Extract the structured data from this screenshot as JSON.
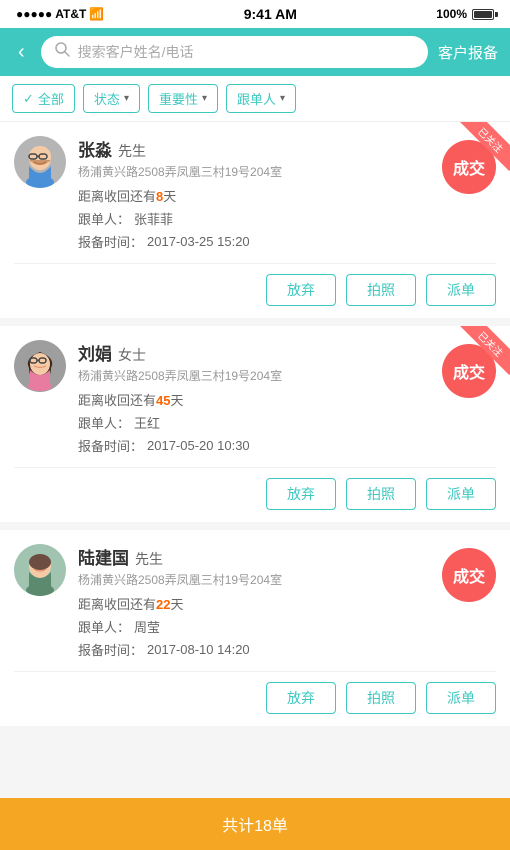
{
  "statusBar": {
    "carrier": "AT&T",
    "wifi": "WiFi",
    "time": "9:41 AM",
    "battery": "100%"
  },
  "header": {
    "back_label": "‹",
    "search_placeholder": "搜索客户姓名/电话",
    "title": "客户报备"
  },
  "filters": [
    {
      "id": "all",
      "label": "全部",
      "active": true,
      "prefix": "✓ "
    },
    {
      "id": "status",
      "label": "状态",
      "active": false,
      "suffix": " ▾"
    },
    {
      "id": "importance",
      "label": "重要性",
      "active": false,
      "suffix": " ▾"
    },
    {
      "id": "follower",
      "label": "跟单人",
      "active": false,
      "suffix": " ▾"
    }
  ],
  "customers": [
    {
      "id": 1,
      "name": "张淼",
      "gender": "先生",
      "address": "杨浦黄兴路2508弄凤凰三村19号204室",
      "days_label": "距离收回还有",
      "days": "8",
      "days_unit": "天",
      "follower_label": "跟单人：",
      "follower": "张菲菲",
      "time_label": "报备时间：",
      "time": "2017-03-25 15:20",
      "deal_label": "成交",
      "badge": "已关注",
      "actions": [
        "放弃",
        "拍照",
        "派单"
      ],
      "avatar_type": "male1"
    },
    {
      "id": 2,
      "name": "刘娟",
      "gender": "女士",
      "address": "杨浦黄兴路2508弄凤凰三村19号204室",
      "days_label": "距离收回还有",
      "days": "45",
      "days_unit": "天",
      "follower_label": "跟单人：",
      "follower": "王红",
      "time_label": "报备时间：",
      "time": "2017-05-20 10:30",
      "deal_label": "成交",
      "badge": "已关注",
      "actions": [
        "放弃",
        "拍照",
        "派单"
      ],
      "avatar_type": "female1"
    },
    {
      "id": 3,
      "name": "陆建国",
      "gender": "先生",
      "address": "杨浦黄兴路2508弄凤凰三村19号204室",
      "days_label": "距离收回还有",
      "days": "22",
      "days_unit": "天",
      "follower_label": "跟单人：",
      "follower": "周莹",
      "time_label": "报备时间：",
      "time": "2017-08-10 14:20",
      "deal_label": "成交",
      "badge": "",
      "actions": [
        "放弃",
        "拍照",
        "派单"
      ],
      "avatar_type": "male2"
    }
  ],
  "bottom": {
    "label": "共计18单"
  }
}
